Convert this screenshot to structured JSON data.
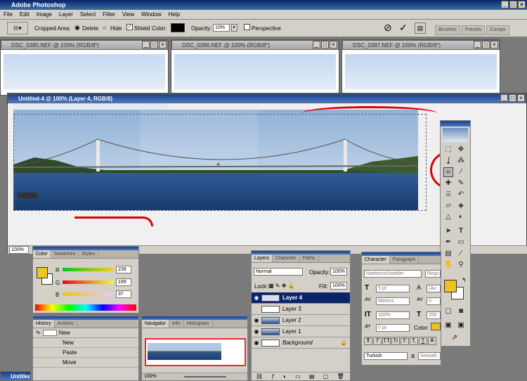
{
  "app_title": "Adobe Photoshop",
  "menu": [
    "File",
    "Edit",
    "Image",
    "Layer",
    "Select",
    "Filter",
    "View",
    "Window",
    "Help"
  ],
  "options": {
    "cropped_area_label": "Cropped Area:",
    "delete_label": "Delete",
    "hide_label": "Hide",
    "shield_label": "Shield",
    "color_label": "Color:",
    "opacity_label": "Opacity:",
    "opacity_value": "10%",
    "perspective_label": "Perspective",
    "palette_tabs": [
      "Brushes",
      "Presets",
      "Comps"
    ]
  },
  "bg_docs": [
    "DSC_0385.NEF @ 100% (RGB/8*)",
    "DSC_0386.NEF @ 100% (RGB/8*)",
    "DSC_0387.NEF @ 100% (RGB/8*)"
  ],
  "main_doc": {
    "title": "Untitled-4 @ 100% (Layer 4, RGB/8)",
    "zoom": "100%"
  },
  "bottom_doc_title": "Untitled",
  "color_panel": {
    "tabs": [
      "Color",
      "Swatches",
      "Styles"
    ],
    "r_label": "R",
    "g_label": "G",
    "b_label": "B",
    "r": "239",
    "g": "199",
    "b": "37",
    "fg_color": "#efc725"
  },
  "history_panel": {
    "tabs": [
      "History",
      "Actions"
    ],
    "snapshot": "New",
    "items": [
      "New",
      "Paste",
      "Move"
    ]
  },
  "navigator_panel": {
    "tabs": [
      "Navigator",
      "Info",
      "Histogram"
    ],
    "zoom": "100%"
  },
  "layers_panel": {
    "tabs": [
      "Layers",
      "Channels",
      "Paths"
    ],
    "mode": "Normal",
    "opacity_label": "Opacity:",
    "opacity": "100%",
    "lock_label": "Lock:",
    "fill_label": "Fill:",
    "fill": "100%",
    "layers": [
      "Layer 4",
      "Layer 3",
      "Layer 2",
      "Layer 1",
      "Background"
    ]
  },
  "character_panel": {
    "tabs": [
      "Character",
      "Paragraph"
    ],
    "font": "Haettenschweiler",
    "style": "Regu",
    "size": "5 pt",
    "leading": "(Au",
    "kerning": "Metrics",
    "tracking": "0",
    "vscale": "100%",
    "hscale": "250",
    "baseline": "0 pt",
    "color_label": "Color:",
    "type_buttons": [
      "T",
      "T",
      "TT",
      "Tr",
      "T'",
      "T,",
      "T",
      "T"
    ],
    "language": "Turkish",
    "aa_label": "a",
    "antialias": "Smooth"
  },
  "toolbox": {
    "fg_color": "#f0c020"
  }
}
